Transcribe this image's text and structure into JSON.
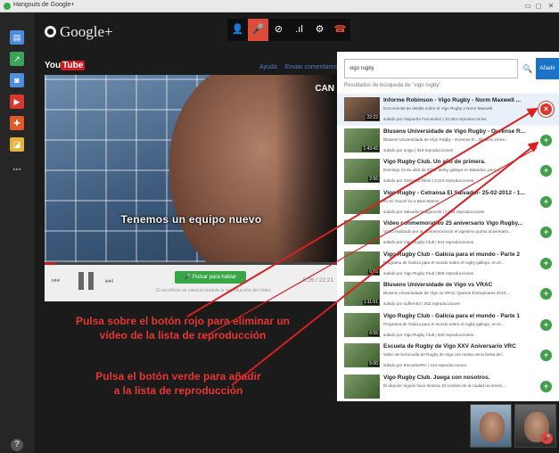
{
  "window": {
    "title": "Hangouts de Google+",
    "controls": [
      "▭",
      "◻",
      "✕"
    ]
  },
  "rail": {
    "items": [
      {
        "name": "chat-icon",
        "color": "#4e8ddb",
        "glyph": "▤"
      },
      {
        "name": "screenshare-icon",
        "color": "#3ba559",
        "glyph": "↗"
      },
      {
        "name": "camera-icon",
        "color": "#4e8ddb",
        "glyph": "◙"
      },
      {
        "name": "youtube-app-icon",
        "color": "#d9372b",
        "glyph": "▶"
      },
      {
        "name": "lifebuoy-icon",
        "color": "#e25a2a",
        "glyph": "✚"
      },
      {
        "name": "effects-icon",
        "color": "#e3b43a",
        "glyph": "◪"
      },
      {
        "name": "more-apps-icon",
        "color": "transparent",
        "glyph": "•••"
      }
    ],
    "help": "?"
  },
  "header": {
    "brand": "Google+"
  },
  "callbar": {
    "buttons": [
      {
        "name": "invite-icon",
        "glyph": "👤",
        "active": false
      },
      {
        "name": "mic-muted-icon",
        "glyph": "🎤",
        "active": true
      },
      {
        "name": "camera-off-icon",
        "glyph": "⊘",
        "active": false
      },
      {
        "name": "signal-icon",
        "glyph": ".ıl",
        "active": false
      },
      {
        "name": "settings-icon",
        "glyph": "⚙",
        "active": false
      },
      {
        "name": "hangup-icon",
        "glyph": "☎",
        "active": false
      }
    ],
    "accent": "#dd4b39"
  },
  "youtube": {
    "logo_you": "You",
    "logo_tube": "Tube",
    "links": [
      "Ayuda",
      "Enviar comentarios"
    ],
    "video": {
      "corner_text": "CAN",
      "subtitle": "Tenemos un equipo nuevo"
    },
    "progress": 0.04,
    "talk_button": "Pulsar para hablar",
    "talk_note": "El micrófono se silencia durante la reproducción del vídeo.",
    "time": "0:26 / 22:21"
  },
  "annotations": {
    "red_button": [
      "Pulsa sobre el botón rojo para eliminar un",
      "vídeo de la lista de  reproducción"
    ],
    "green_button": [
      "Pulsa el botón verde para añadir",
      "a la lista de reproducción"
    ],
    "color": "#e53535"
  },
  "panel": {
    "search_value": "vigo rugby",
    "add_label": "Añadir",
    "results_label": "Resultados de búsqueda de \"vigo rugby\"",
    "results": [
      {
        "title": "Informe Robinson - Vigo Rugby - Norm Maxwell ...",
        "desc": "Documental de detalle sobre el Vigo Rugby y Norm Maxwell",
        "desc2": "",
        "meta": "subido por Alejandro Fernandez | 10.364 reproducciones",
        "duration": "22:22",
        "action": "remove",
        "selected": true
      },
      {
        "title": "Blusens Universidade de Vigo Rugby - Ourense R...",
        "desc": "Blusens Universidade de Vigo Rugby - Ourense R... Blusens Unive...",
        "desc2": "",
        "meta": "subido por unigo | 919 reproducciones",
        "duration": "1:43:42",
        "action": "add",
        "selected": false
      },
      {
        "title": "Vigo Rugby Club. Un año de primera.",
        "desc": "Domingo 15 de abril de 2012, derby gallego en Balaídos, pero e...",
        "desc2": "",
        "meta": "subido por Sinborbo Films | 3.313 reproducciones",
        "duration": "2:56",
        "action": "add",
        "selected": false
      },
      {
        "title": "Vigo Rugby - Cetransa El Salvador- 25-02-2012 - 1...",
        "desc": "ex-11 Youcef ex-2 Dani Marion",
        "desc2": "",
        "meta": "subido por Salvador Borgoncelo | 2.084 reproducciones",
        "duration": "",
        "action": "add",
        "selected": false
      },
      {
        "title": "Video conmemorativo 25 aniversario Vigo Rugby...",
        "desc": "Video realizado por la conmemoración el vigesimo quinto aniversario...",
        "desc2": "",
        "meta": "subido por Vigo Rugby Club | 941 reproducciones",
        "duration": "",
        "action": "add",
        "selected": false
      },
      {
        "title": "Vigo Rugby Club - Galicia para el mundo - Parte 2",
        "desc": "Programa de Galicia para el mundo sobre el rugby gallego, en el...",
        "desc2": "",
        "meta": "subido por Vigo Rugby Club | 808 reproducciones",
        "duration": "6:53",
        "action": "add",
        "selected": false
      },
      {
        "title": "Blusens Universidade de Vigo vs VRAC",
        "desc": "Blusens Universidade de Vigo vs VRAC Quesos Entrepinares 2013-...",
        "desc2": "",
        "meta": "subido por suffern63 | 253 reproducciones",
        "duration": "1:11:51",
        "action": "add",
        "selected": false
      },
      {
        "title": "Vigo Rugby Club - Galicia para el mundo - Parte 1",
        "desc": "Programa de Galicia para el mundo sobre el rugby gallego, en el...",
        "desc2": "",
        "meta": "subido por Vigo Rugby Club | 628 reproducciones",
        "duration": "6:55",
        "action": "add",
        "selected": false
      },
      {
        "title": "Escuela de Rugby de Vigo XXV Aniversario VRC",
        "desc": "Video de la Escuela de Rugby de Vigo con motivo de la fiesta del...",
        "desc2": "",
        "meta": "subido por EscuelaVRC | 414 reproducciones",
        "duration": "5:00",
        "action": "add",
        "selected": false
      },
      {
        "title": "Vigo Rugby Club. Juega con nosotros.",
        "desc": "El deporte Vigués hace historia. El nombre de la ciudad recorrerá ...",
        "desc2": "",
        "meta": "",
        "duration": "",
        "action": "add",
        "selected": false
      }
    ]
  },
  "participants": [
    {
      "name": "participant-1",
      "muted": false
    },
    {
      "name": "participant-2",
      "muted": true
    }
  ]
}
